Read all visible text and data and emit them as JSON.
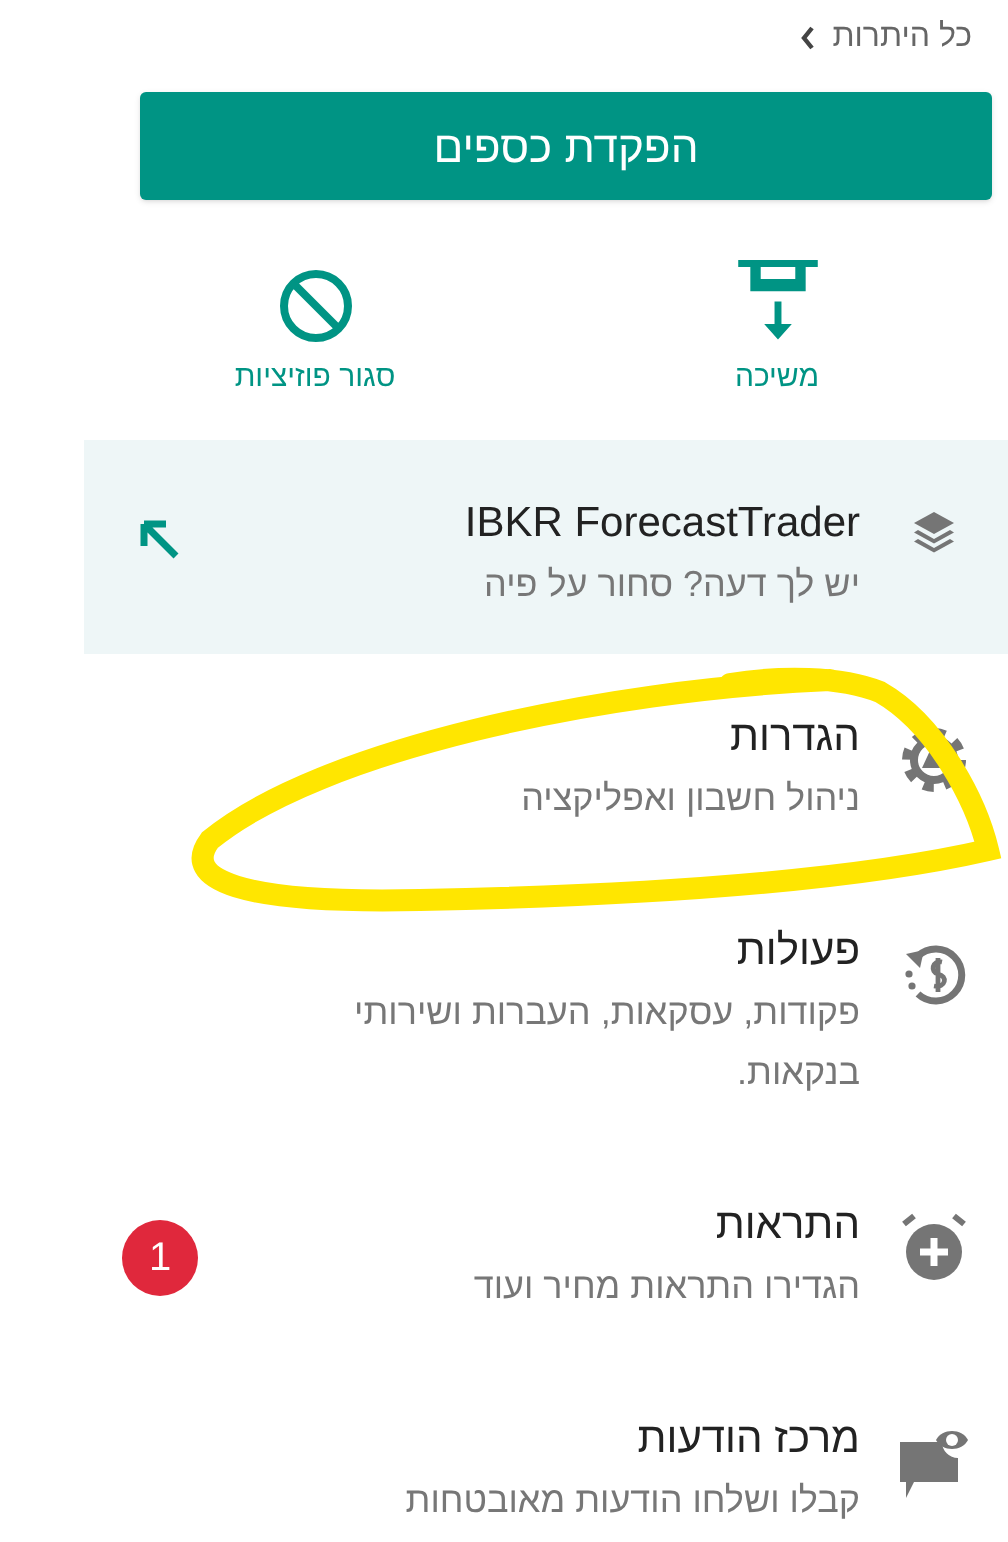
{
  "header": {
    "link": "כל היתרות"
  },
  "deposit_button": "הפקדת כספים",
  "actions": [
    {
      "label": "משיכה"
    },
    {
      "label": "סגור פוזיציות"
    }
  ],
  "menu": [
    {
      "kind": "promo",
      "title": "IBKR ForecastTrader",
      "subtitle": "יש לך דעה? סחור על פיה"
    },
    {
      "kind": "item",
      "title": "הגדרות",
      "subtitle": "ניהול חשבון ואפליקציה"
    },
    {
      "kind": "item",
      "title": "פעולות",
      "subtitle": "פקודות, עסקאות, העברות ושירותי בנקאות."
    },
    {
      "kind": "item",
      "title": "התראות",
      "subtitle": "הגדירו התראות מחיר ועוד",
      "badge": "1"
    },
    {
      "kind": "item",
      "title": "מרכז הודעות",
      "subtitle": "קבלו ושלחו הודעות מאובטחות"
    }
  ]
}
